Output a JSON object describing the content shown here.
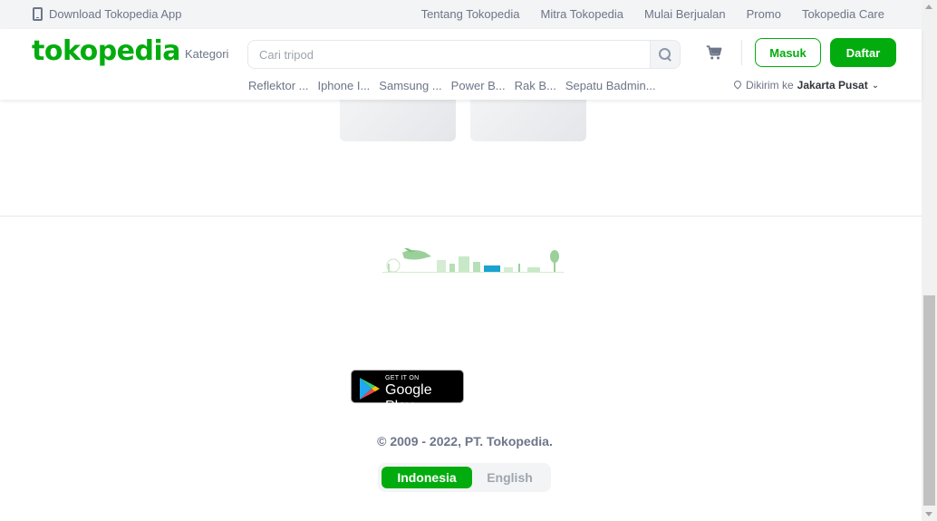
{
  "topbar": {
    "download_label": "Download Tokopedia App",
    "links": [
      "Tentang Tokopedia",
      "Mitra Tokopedia",
      "Mulai Berjualan",
      "Promo",
      "Tokopedia Care"
    ]
  },
  "header": {
    "logo": "tokopedia",
    "kategori": "Kategori",
    "search_placeholder": "Cari tripod",
    "login_label": "Masuk",
    "register_label": "Daftar",
    "suggestions": [
      "Reflektor ...",
      "Iphone I...",
      "Samsung ...",
      "Power B...",
      "Rak B...",
      "Sepatu Badmin..."
    ],
    "location_prefix": "Dikirim ke",
    "location_city": "Jakarta Pusat"
  },
  "footer": {
    "store_badge_top": "GET IT ON",
    "store_badge_main": "Google Play",
    "copyright": "© 2009 - 2022, PT. Tokopedia.",
    "languages": [
      "Indonesia",
      "English"
    ],
    "active_language": "Indonesia"
  },
  "colors": {
    "brand_green": "#03ac0e",
    "text_muted": "#6d7588",
    "border": "#e4e7ed"
  }
}
